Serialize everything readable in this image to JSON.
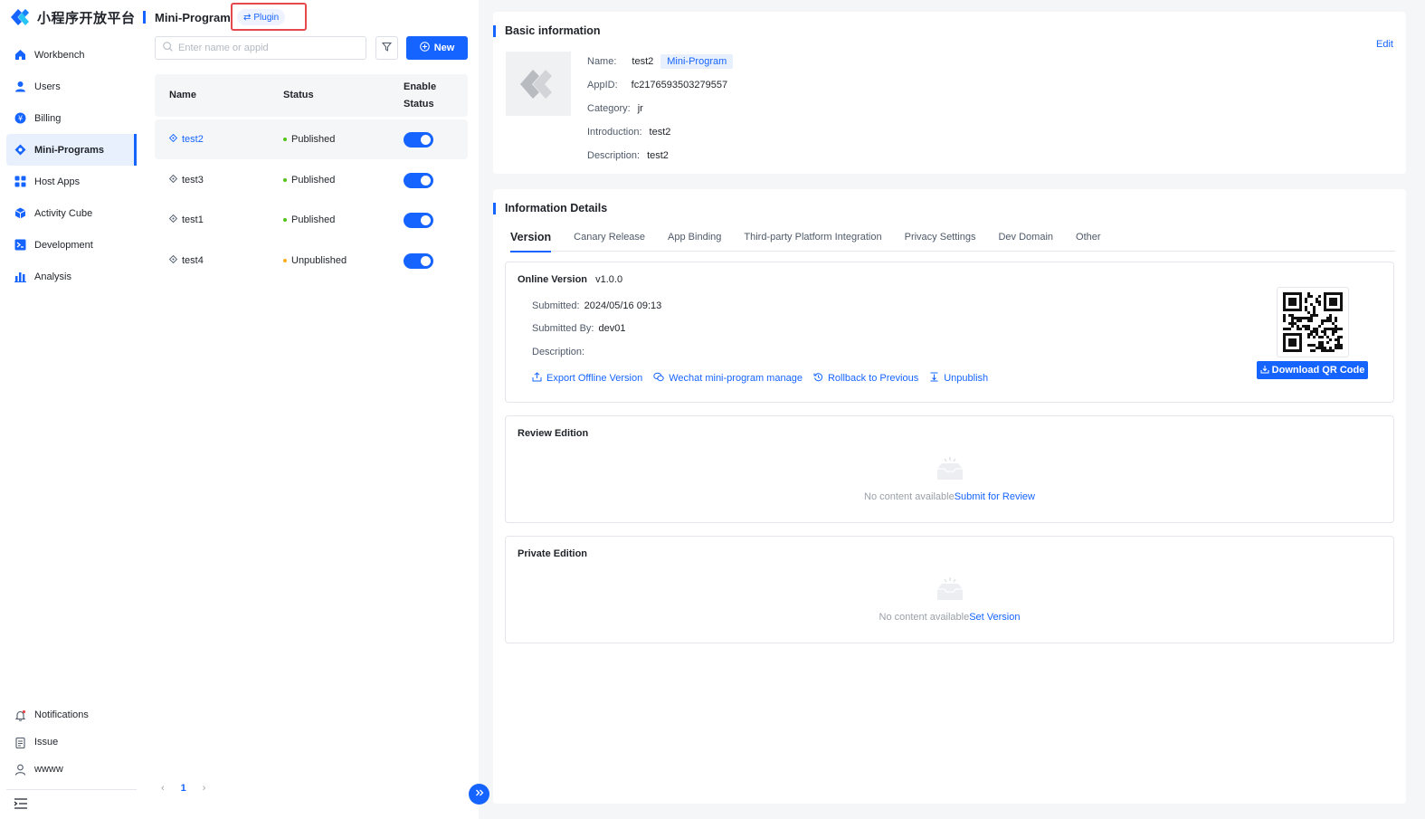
{
  "brand": {
    "title": "小程序开放平台"
  },
  "sidebar": {
    "items": [
      {
        "label": "Workbench",
        "icon": "home-icon"
      },
      {
        "label": "Users",
        "icon": "user-icon"
      },
      {
        "label": "Billing",
        "icon": "billing-icon"
      },
      {
        "label": "Mini-Programs",
        "icon": "mini-program-icon",
        "active": true
      },
      {
        "label": "Host Apps",
        "icon": "grid-icon"
      },
      {
        "label": "Activity Cube",
        "icon": "cube-icon"
      },
      {
        "label": "Development",
        "icon": "terminal-icon"
      },
      {
        "label": "Analysis",
        "icon": "bar-chart-icon"
      }
    ],
    "bottom": [
      {
        "label": "Notifications",
        "icon": "bell-icon"
      },
      {
        "label": "Issue",
        "icon": "clipboard-icon"
      },
      {
        "label": "wwww",
        "icon": "person-icon"
      }
    ]
  },
  "list": {
    "title": "Mini-Program",
    "plugin_label": "Plugin",
    "search_placeholder": "Enter name or appid",
    "new_label": "New",
    "columns": {
      "name": "Name",
      "status": "Status",
      "enable_line1": "Enable",
      "enable_line2": "Status"
    },
    "rows": [
      {
        "name": "test2",
        "status": "Published",
        "enabled": true,
        "selected": true
      },
      {
        "name": "test3",
        "status": "Published",
        "enabled": true
      },
      {
        "name": "test1",
        "status": "Published",
        "enabled": true
      },
      {
        "name": "test4",
        "status": "Unpublished",
        "enabled": true
      }
    ],
    "pagination": {
      "current": "1",
      "prev": "‹",
      "next": "›"
    }
  },
  "basic": {
    "title": "Basic information",
    "edit_label": "Edit",
    "name_label": "Name:",
    "name_value": "test2",
    "type_tag": "Mini-Program",
    "appid_label": "AppID:",
    "appid_value": "fc2176593503279557",
    "category_label": "Category:",
    "category_value": "jr",
    "intro_label": "Introduction:",
    "intro_value": "test2",
    "desc_label": "Description:",
    "desc_value": "test2"
  },
  "details": {
    "title": "Information Details",
    "tabs": [
      "Version",
      "Canary Release",
      "App Binding",
      "Third-party Platform Integration",
      "Privacy Settings",
      "Dev Domain",
      "Other"
    ],
    "online": {
      "title": "Online Version",
      "version": "v1.0.0",
      "submitted_label": "Submitted:",
      "submitted_value": "2024/05/16 09:13",
      "submitted_by_label": "Submitted By:",
      "submitted_by_value": "dev01",
      "description_label": "Description:",
      "actions": [
        "Export Offline Version",
        "Wechat mini-program manage",
        "Rollback to Previous",
        "Unpublish"
      ],
      "qr_button": "Download QR Code"
    },
    "review": {
      "title": "Review Edition",
      "empty_text": "No content available",
      "link_text": "Submit for Review"
    },
    "private": {
      "title": "Private Edition",
      "empty_text": "No content available",
      "link_text": "Set Version"
    }
  },
  "colors": {
    "primary": "#1664ff",
    "published": "#52c41a",
    "unpublished": "#faad14",
    "highlight_box": "#e5484d"
  }
}
